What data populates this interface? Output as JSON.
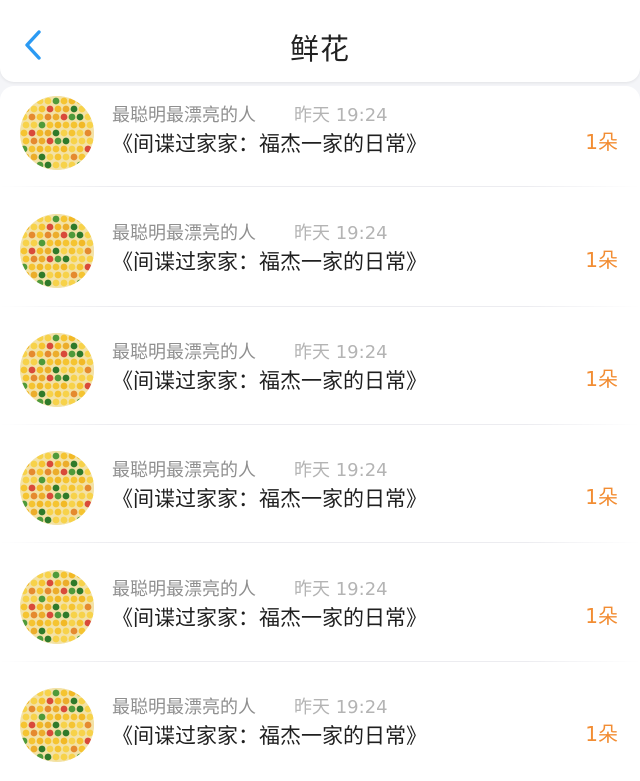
{
  "header": {
    "title": "鲜花",
    "back_icon": "chevron-left-icon",
    "accent_color": "#2b9af3"
  },
  "records": [
    {
      "user": "最聪明最漂亮的人",
      "time": "昨天 19:24",
      "work": "《间谍过家家：福杰一家的日常》",
      "count": "1朵"
    },
    {
      "user": "最聪明最漂亮的人",
      "time": "昨天 19:24",
      "work": "《间谍过家家：福杰一家的日常》",
      "count": "1朵"
    },
    {
      "user": "最聪明最漂亮的人",
      "time": "昨天 19:24",
      "work": "《间谍过家家：福杰一家的日常》",
      "count": "1朵"
    },
    {
      "user": "最聪明最漂亮的人",
      "time": "昨天 19:24",
      "work": "《间谍过家家：福杰一家的日常》",
      "count": "1朵"
    },
    {
      "user": "最聪明最漂亮的人",
      "time": "昨天 19:24",
      "work": "《间谍过家家：福杰一家的日常》",
      "count": "1朵"
    },
    {
      "user": "最聪明最漂亮的人",
      "time": "昨天 19:24",
      "work": "《间谍过家家：福杰一家的日常》",
      "count": "1朵"
    }
  ],
  "colors": {
    "count": "#f28d33",
    "username": "#8f8f8f",
    "timestamp": "#b4b4b4"
  }
}
